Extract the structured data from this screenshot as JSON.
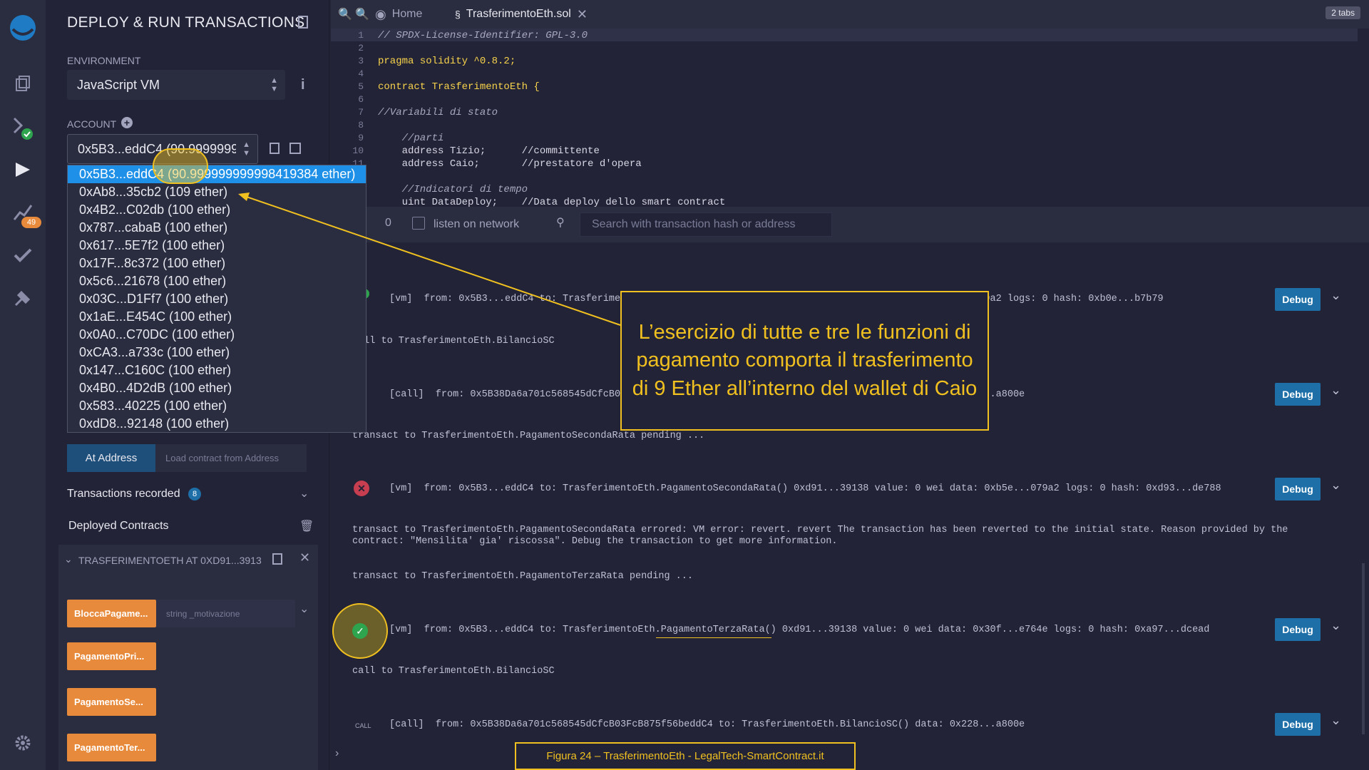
{
  "panel": {
    "title": "DEPLOY & RUN TRANSACTIONS",
    "environment_label": "ENVIRONMENT",
    "environment_value": "JavaScript VM",
    "account_label": "ACCOUNT",
    "account_value": "0x5B3...eddC4 (90.9999999",
    "accounts": [
      "0x5B3...eddC4 (90.999999999998419384 ether)",
      "0xAb8...35cb2 (109 ether)",
      "0x4B2...C02db (100 ether)",
      "0x787...cabaB (100 ether)",
      "0x617...5E7f2 (100 ether)",
      "0x17F...8c372 (100 ether)",
      "0x5c6...21678 (100 ether)",
      "0x03C...D1Ff7 (100 ether)",
      "0x1aE...E454C (100 ether)",
      "0x0A0...C70DC (100 ether)",
      "0xCA3...a733c (100 ether)",
      "0x147...C160C (100 ether)",
      "0x4B0...4D2dB (100 ether)",
      "0x583...40225 (100 ether)",
      "0xdD8...92148 (100 ether)"
    ],
    "at_address_label": "At Address",
    "load_placeholder": "Load contract from Address",
    "transactions_recorded_label": "Transactions recorded",
    "transactions_count": "8",
    "deployed_label": "Deployed Contracts",
    "instance_label": "TRASFERIMENTOETH AT 0XD91...3913",
    "functions": [
      "BloccaPagame...",
      "PagamentoPri...",
      "PagamentoSe...",
      "PagamentoTer..."
    ],
    "func_param_placeholder": "string _motivazione",
    "badge_count": "49"
  },
  "editor": {
    "tabs": [
      "Home",
      "TrasferimentoEth.sol"
    ],
    "tabs_count": "2 tabs",
    "lines": [
      {
        "n": "1",
        "t": "// SPDX-License-Identifier: GPL-3.0",
        "c": "cm"
      },
      {
        "n": "2",
        "t": "",
        "c": ""
      },
      {
        "n": "3",
        "t": "pragma solidity ^0.8.2;",
        "c": "kw"
      },
      {
        "n": "4",
        "t": "",
        "c": ""
      },
      {
        "n": "5",
        "t": "contract TrasferimentoEth {",
        "c": "kw"
      },
      {
        "n": "6",
        "t": "",
        "c": ""
      },
      {
        "n": "7",
        "t": "//Variabili di stato",
        "c": "cm"
      },
      {
        "n": "8",
        "t": "",
        "c": ""
      },
      {
        "n": "9",
        "t": "    //parti",
        "c": "cm"
      },
      {
        "n": "10",
        "t": "    address Tizio;      //committente",
        "c": ""
      },
      {
        "n": "11",
        "t": "    address Caio;       //prestatore d'opera",
        "c": ""
      },
      {
        "n": "12",
        "t": "",
        "c": ""
      },
      {
        "n": "13",
        "t": "    //Indicatori di tempo",
        "c": "cm"
      },
      {
        "n": "14",
        "t": "    uint DataDeploy;    //Data deploy dello smart contract",
        "c": ""
      }
    ]
  },
  "terminal": {
    "counter": "0",
    "listen_label": "listen on network",
    "search_placeholder": "Search with transaction hash or address",
    "debug_label": "Debug",
    "logs": [
      "[vm]  from: 0x5B3...eddC4 to: TrasferimentoEth.BilancioSC() 0xd91...39138 value: 0 wei data: 0xb5e...079a2 logs: 0 hash: 0xb0e...b7b79",
      "call to TrasferimentoEth.BilancioSC",
      "[call]  from: 0x5B38Da6a701c568545dCfcB03FcB875f56beddC4 to: TrasferimentoEth.BilancioSC() data: 0x228...a800e",
      "transact to TrasferimentoEth.PagamentoSecondaRata pending ...",
      "[vm]  from: 0x5B3...eddC4 to: TrasferimentoEth.PagamentoSecondaRata() 0xd91...39138 value: 0 wei data: 0xb5e...079a2 logs: 0 hash: 0xd93...de788",
      "transact to TrasferimentoEth.PagamentoSecondaRata errored: VM error: revert. revert The transaction has been reverted to the initial state. Reason provided by the",
      "contract: \"Mensilita' gia' riscossa\". Debug the transaction to get more information.",
      "transact to TrasferimentoEth.PagamentoTerzaRata pending ...",
      "[vm]  from: 0x5B3...eddC4 to: TrasferimentoEth.PagamentoTerzaRata() 0xd91...39138 value: 0 wei data: 0x30f...e764e logs: 0 hash: 0xa97...dcead",
      "call to TrasferimentoEth.BilancioSC",
      "[call]  from: 0x5B38Da6a701c568545dCfcB03FcB875f56beddC4 to: TrasferimentoEth.BilancioSC() data: 0x228...a800e"
    ],
    "call_tag": "CALL"
  },
  "callout": "L’esercizio di tutte e tre le funzioni di pagamento comporta il trasferimento di 9 Ether all’interno del wallet di Caio",
  "caption": "Figura 24 – TrasferimentoEth - LegalTech-SmartContract.it",
  "colors": {
    "accent_orange": "#e88a3c",
    "debug_blue": "#1e6fa8",
    "highlight_yellow": "#f0c020",
    "selected_blue": "#1e90e8"
  }
}
